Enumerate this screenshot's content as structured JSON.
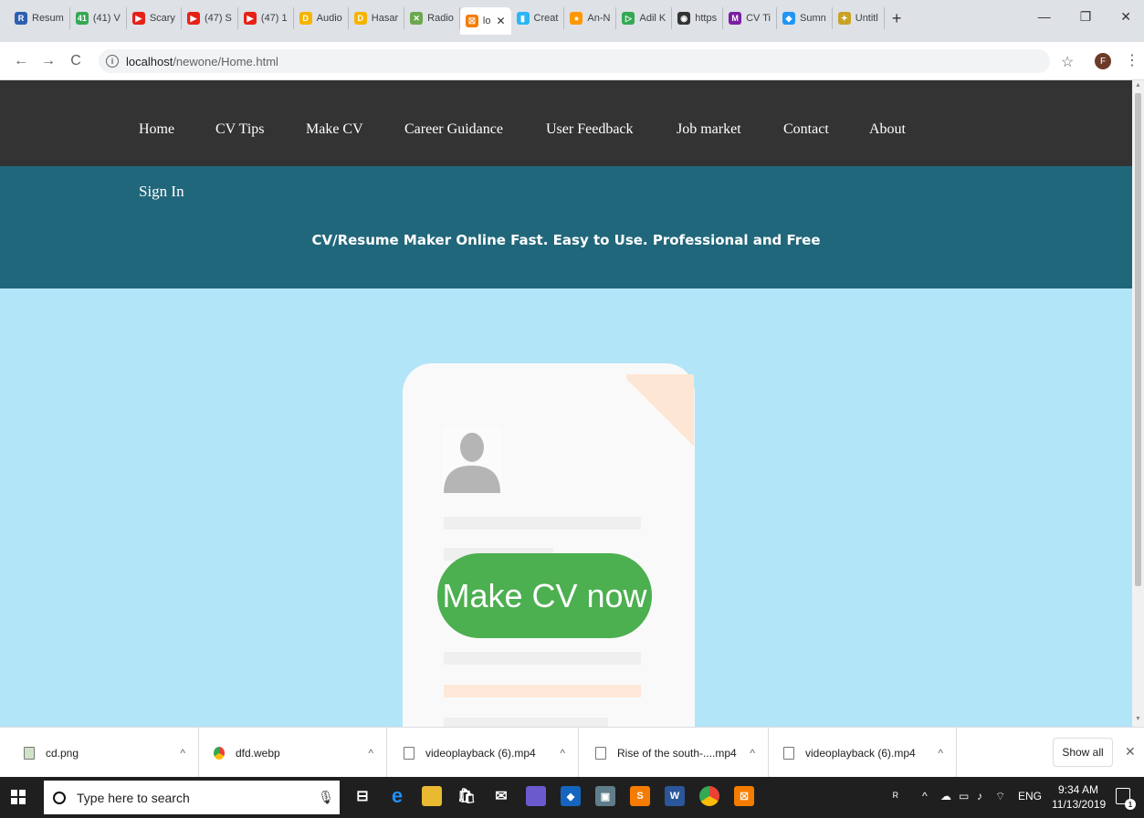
{
  "browser": {
    "tabs": [
      {
        "label": "Resum",
        "icon": "R",
        "color": "#2d5fb0"
      },
      {
        "label": "(41) V",
        "icon": "41",
        "color": "#34a853"
      },
      {
        "label": "Scary",
        "icon": "▶",
        "color": "#e62117"
      },
      {
        "label": "(47) S",
        "icon": "▶",
        "color": "#e62117"
      },
      {
        "label": "(47) 1",
        "icon": "▶",
        "color": "#e62117"
      },
      {
        "label": "Audio",
        "icon": "D",
        "color": "#f4b400"
      },
      {
        "label": "Hasar",
        "icon": "D",
        "color": "#f4b400"
      },
      {
        "label": "Radio",
        "icon": "✕",
        "color": "#6aa84f"
      },
      {
        "label": "lo",
        "icon": "☒",
        "color": "#f57c00",
        "active": true
      },
      {
        "label": "Creat",
        "icon": "▮",
        "color": "#29b6f6"
      },
      {
        "label": "An-N",
        "icon": "●",
        "color": "#ff9800"
      },
      {
        "label": "Adil K",
        "icon": "▷",
        "color": "#34a853"
      },
      {
        "label": "https",
        "icon": "◉",
        "color": "#333333"
      },
      {
        "label": "CV Ti",
        "icon": "M",
        "color": "#7b1fa2"
      },
      {
        "label": "Sumn",
        "icon": "◆",
        "color": "#2196f3"
      },
      {
        "label": "Untitl",
        "icon": "✦",
        "color": "#c9a227"
      }
    ],
    "new_tab": "+",
    "url_host": "localhost",
    "url_path": "/newone/Home.html",
    "profile_initial": "F"
  },
  "nav": {
    "items": [
      "Home",
      "CV Tips",
      "Make CV",
      "Career Guidance",
      "User Feedback",
      "Job market",
      "Contact",
      "About"
    ],
    "sign_in": "Sign In"
  },
  "hero": {
    "tagline": "CV/Resume Maker Online Fast. Easy to Use. Professional and Free"
  },
  "cta": {
    "label": "Make CV now",
    "color": "#4caf50"
  },
  "downloads": {
    "files": [
      "cd.png",
      "dfd.webp",
      "videoplayback (6).mp4",
      "Rise of the south-....mp4",
      "videoplayback (6).mp4"
    ],
    "show_all": "Show all"
  },
  "taskbar": {
    "search_placeholder": "Type here to search",
    "language": "ENG",
    "time": "9:34 AM",
    "date": "11/13/2019",
    "notification_count": "1"
  }
}
